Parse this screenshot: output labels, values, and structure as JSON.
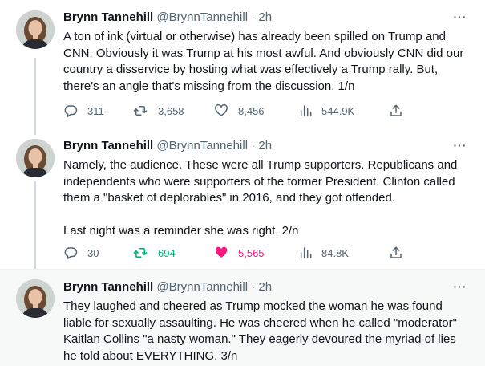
{
  "colors": {
    "text": "#0f1419",
    "secondary": "#536471",
    "retweet_active": "#00ba7c",
    "like_active": "#f91880",
    "thread_line": "#cfd9de"
  },
  "tweets": [
    {
      "name": "Brynn Tannehill",
      "handle": "@BrynnTannehill",
      "separator": "·",
      "time": "2h",
      "more": "···",
      "text": "A ton of ink (virtual or otherwise) has already been spilled on Trump and CNN. Obviously it was Trump at his most awful. And obviously CNN did our country a disservice by hosting what was effectively a Trump rally. But, there's an angle that's missing from the discussion. 1/n",
      "replies": "311",
      "retweets": "3,658",
      "likes": "8,456",
      "views": "544.9K",
      "retweeted": false,
      "liked": false
    },
    {
      "name": "Brynn Tannehill",
      "handle": "@BrynnTannehill",
      "separator": "·",
      "time": "2h",
      "more": "···",
      "text": "Namely, the audience. These were all Trump supporters. Republicans and independents who were supporters of the former President. Clinton called them a \"basket of deplorables\" in 2016, and they got offended.\n\nLast night was a reminder she was right. 2/n",
      "replies": "30",
      "retweets": "694",
      "likes": "5,565",
      "views": "84.8K",
      "retweeted": true,
      "liked": true
    },
    {
      "name": "Brynn Tannehill",
      "handle": "@BrynnTannehill",
      "separator": "·",
      "time": "2h",
      "more": "···",
      "text": "They laughed and cheered as Trump mocked the woman he was found liable for sexually assaulting. He was cheered when he called \"moderator\" Kaitlan Collins \"a nasty woman.\" They eagerly devoured the myriad of lies he told about EVERYTHING. 3/n"
    }
  ]
}
